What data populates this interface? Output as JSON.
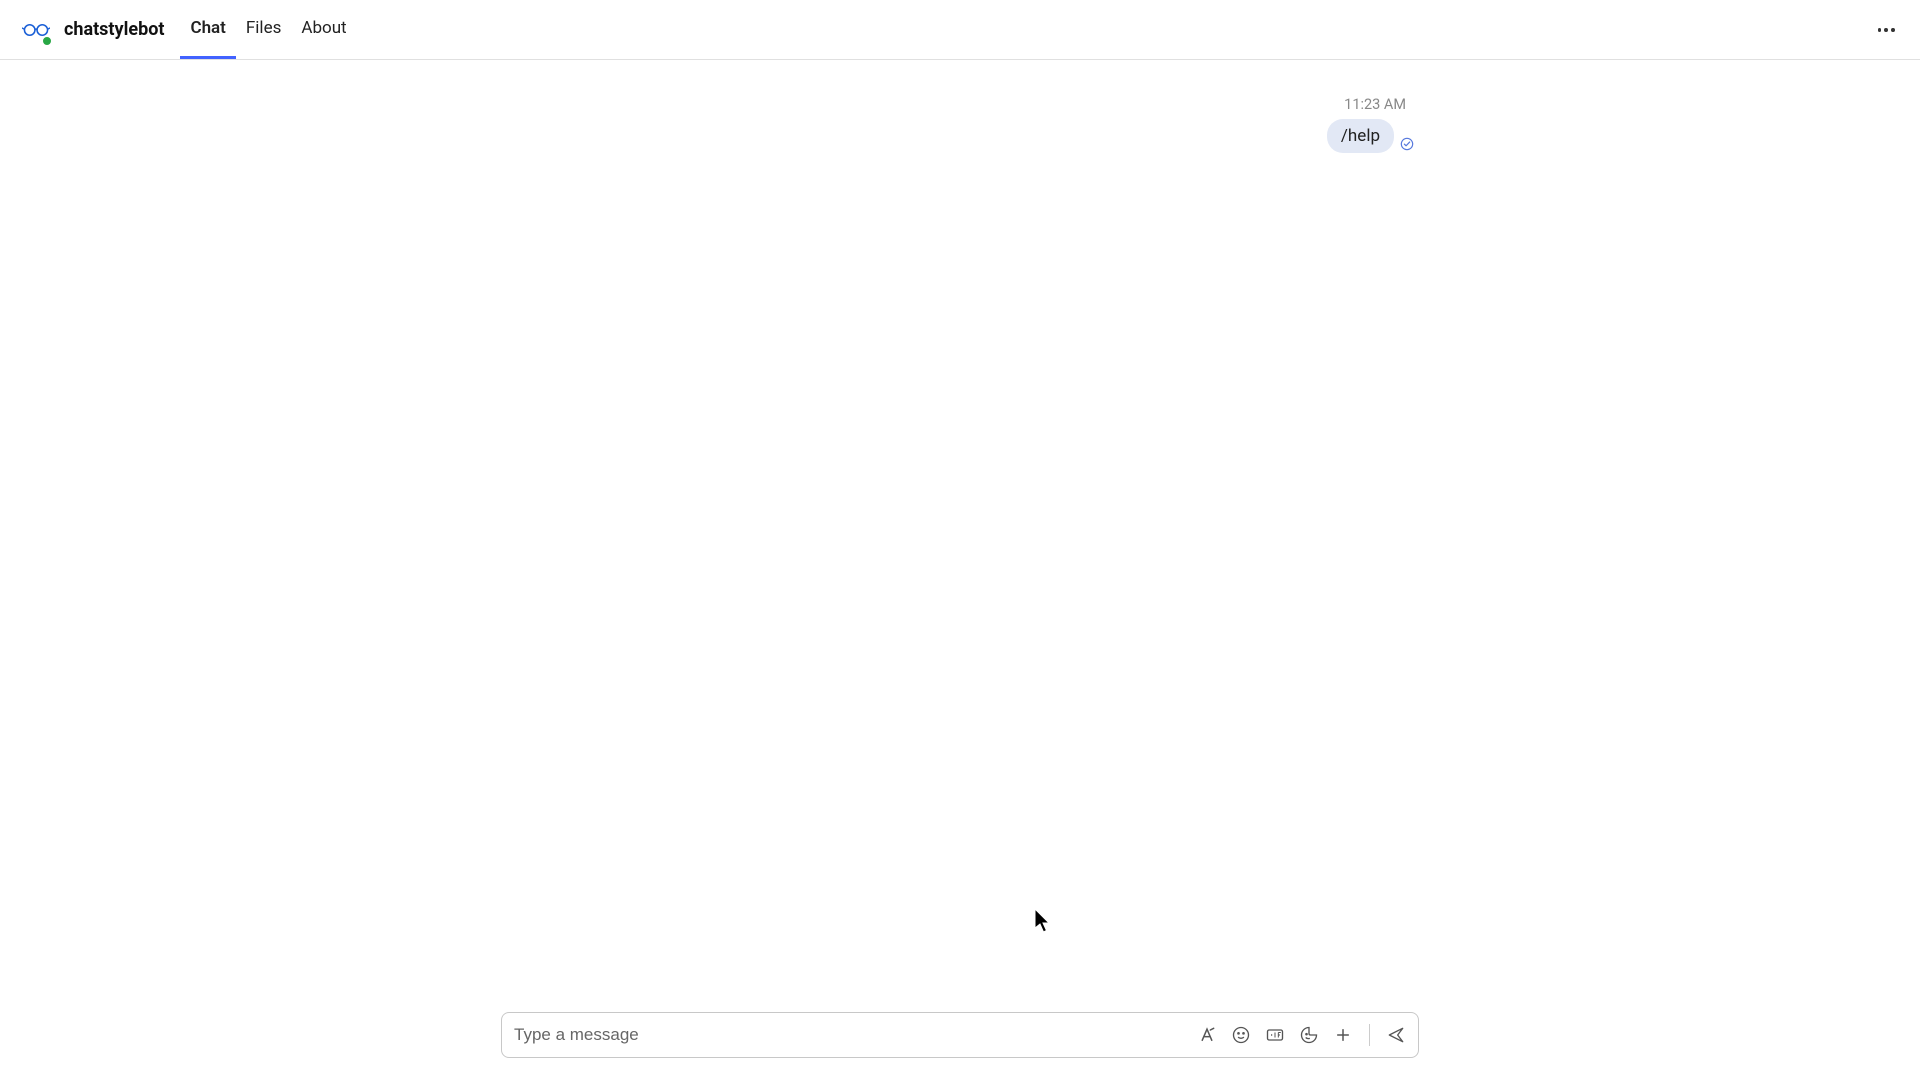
{
  "header": {
    "bot_name": "chatstylebot",
    "tabs": [
      {
        "label": "Chat",
        "active": true
      },
      {
        "label": "Files",
        "active": false
      },
      {
        "label": "About",
        "active": false
      }
    ],
    "avatar_icon": "glasses-icon",
    "presence": "online"
  },
  "chat": {
    "messages": [
      {
        "timestamp": "11:23 AM",
        "text": "/help",
        "direction": "outgoing",
        "status": "sent"
      }
    ]
  },
  "composer": {
    "placeholder": "Type a message",
    "value": "",
    "icons": [
      "format-icon",
      "emoji-icon",
      "gif-icon",
      "sticker-icon",
      "plus-icon",
      "send-icon"
    ]
  }
}
